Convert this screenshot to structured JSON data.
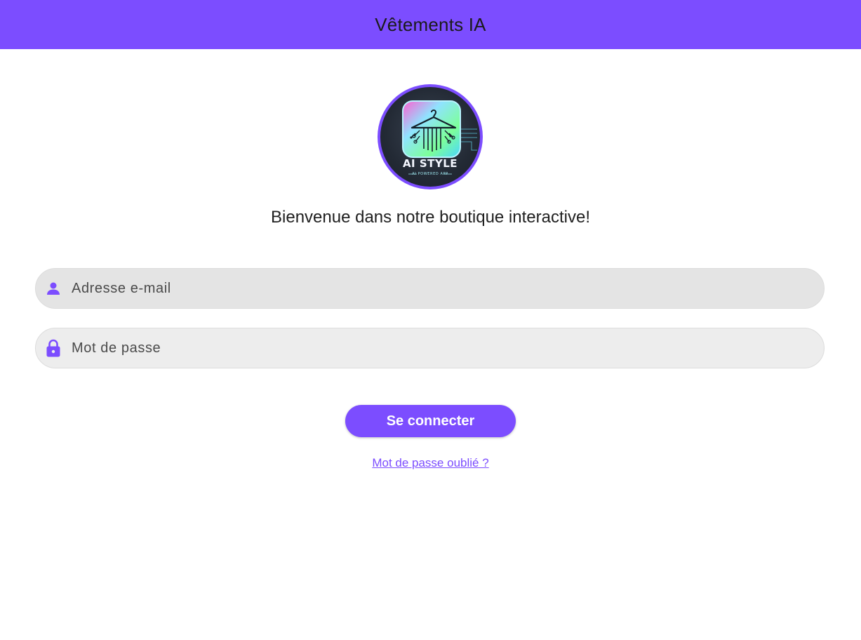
{
  "app": {
    "title": "Vêtements IA",
    "accent_color": "#7c4dff"
  },
  "logo": {
    "text": "AI STYLE",
    "subtext": "AI POWERED APP",
    "icon": "hanger-circuit-icon"
  },
  "welcome_text": "Bienvenue dans notre boutique interactive!",
  "form": {
    "email": {
      "placeholder": "Adresse e-mail",
      "value": "",
      "icon": "person-icon"
    },
    "password": {
      "placeholder": "Mot de passe",
      "value": "",
      "icon": "lock-icon"
    },
    "login_label": "Se connecter",
    "forgot_label": "Mot de passe oublié ?"
  }
}
